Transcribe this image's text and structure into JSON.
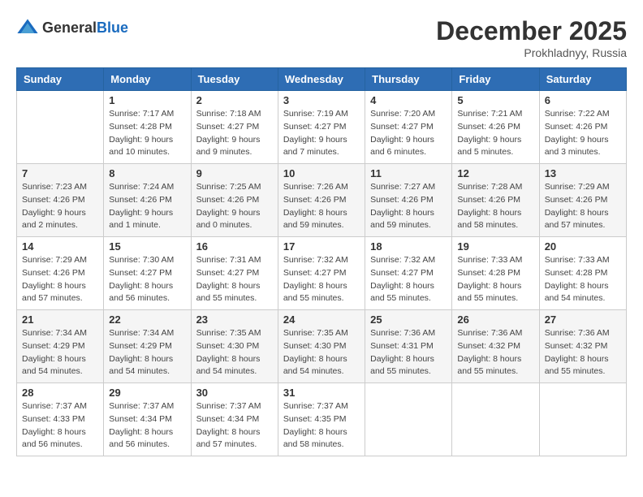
{
  "logo": {
    "general": "General",
    "blue": "Blue"
  },
  "title": "December 2025",
  "location": "Prokhladnyy, Russia",
  "days_of_week": [
    "Sunday",
    "Monday",
    "Tuesday",
    "Wednesday",
    "Thursday",
    "Friday",
    "Saturday"
  ],
  "weeks": [
    [
      {
        "day": "",
        "info": ""
      },
      {
        "day": "1",
        "info": "Sunrise: 7:17 AM\nSunset: 4:28 PM\nDaylight: 9 hours\nand 10 minutes."
      },
      {
        "day": "2",
        "info": "Sunrise: 7:18 AM\nSunset: 4:27 PM\nDaylight: 9 hours\nand 9 minutes."
      },
      {
        "day": "3",
        "info": "Sunrise: 7:19 AM\nSunset: 4:27 PM\nDaylight: 9 hours\nand 7 minutes."
      },
      {
        "day": "4",
        "info": "Sunrise: 7:20 AM\nSunset: 4:27 PM\nDaylight: 9 hours\nand 6 minutes."
      },
      {
        "day": "5",
        "info": "Sunrise: 7:21 AM\nSunset: 4:26 PM\nDaylight: 9 hours\nand 5 minutes."
      },
      {
        "day": "6",
        "info": "Sunrise: 7:22 AM\nSunset: 4:26 PM\nDaylight: 9 hours\nand 3 minutes."
      }
    ],
    [
      {
        "day": "7",
        "info": "Sunrise: 7:23 AM\nSunset: 4:26 PM\nDaylight: 9 hours\nand 2 minutes."
      },
      {
        "day": "8",
        "info": "Sunrise: 7:24 AM\nSunset: 4:26 PM\nDaylight: 9 hours\nand 1 minute."
      },
      {
        "day": "9",
        "info": "Sunrise: 7:25 AM\nSunset: 4:26 PM\nDaylight: 9 hours\nand 0 minutes."
      },
      {
        "day": "10",
        "info": "Sunrise: 7:26 AM\nSunset: 4:26 PM\nDaylight: 8 hours\nand 59 minutes."
      },
      {
        "day": "11",
        "info": "Sunrise: 7:27 AM\nSunset: 4:26 PM\nDaylight: 8 hours\nand 59 minutes."
      },
      {
        "day": "12",
        "info": "Sunrise: 7:28 AM\nSunset: 4:26 PM\nDaylight: 8 hours\nand 58 minutes."
      },
      {
        "day": "13",
        "info": "Sunrise: 7:29 AM\nSunset: 4:26 PM\nDaylight: 8 hours\nand 57 minutes."
      }
    ],
    [
      {
        "day": "14",
        "info": "Sunrise: 7:29 AM\nSunset: 4:26 PM\nDaylight: 8 hours\nand 57 minutes."
      },
      {
        "day": "15",
        "info": "Sunrise: 7:30 AM\nSunset: 4:27 PM\nDaylight: 8 hours\nand 56 minutes."
      },
      {
        "day": "16",
        "info": "Sunrise: 7:31 AM\nSunset: 4:27 PM\nDaylight: 8 hours\nand 55 minutes."
      },
      {
        "day": "17",
        "info": "Sunrise: 7:32 AM\nSunset: 4:27 PM\nDaylight: 8 hours\nand 55 minutes."
      },
      {
        "day": "18",
        "info": "Sunrise: 7:32 AM\nSunset: 4:27 PM\nDaylight: 8 hours\nand 55 minutes."
      },
      {
        "day": "19",
        "info": "Sunrise: 7:33 AM\nSunset: 4:28 PM\nDaylight: 8 hours\nand 55 minutes."
      },
      {
        "day": "20",
        "info": "Sunrise: 7:33 AM\nSunset: 4:28 PM\nDaylight: 8 hours\nand 54 minutes."
      }
    ],
    [
      {
        "day": "21",
        "info": "Sunrise: 7:34 AM\nSunset: 4:29 PM\nDaylight: 8 hours\nand 54 minutes."
      },
      {
        "day": "22",
        "info": "Sunrise: 7:34 AM\nSunset: 4:29 PM\nDaylight: 8 hours\nand 54 minutes."
      },
      {
        "day": "23",
        "info": "Sunrise: 7:35 AM\nSunset: 4:30 PM\nDaylight: 8 hours\nand 54 minutes."
      },
      {
        "day": "24",
        "info": "Sunrise: 7:35 AM\nSunset: 4:30 PM\nDaylight: 8 hours\nand 54 minutes."
      },
      {
        "day": "25",
        "info": "Sunrise: 7:36 AM\nSunset: 4:31 PM\nDaylight: 8 hours\nand 55 minutes."
      },
      {
        "day": "26",
        "info": "Sunrise: 7:36 AM\nSunset: 4:32 PM\nDaylight: 8 hours\nand 55 minutes."
      },
      {
        "day": "27",
        "info": "Sunrise: 7:36 AM\nSunset: 4:32 PM\nDaylight: 8 hours\nand 55 minutes."
      }
    ],
    [
      {
        "day": "28",
        "info": "Sunrise: 7:37 AM\nSunset: 4:33 PM\nDaylight: 8 hours\nand 56 minutes."
      },
      {
        "day": "29",
        "info": "Sunrise: 7:37 AM\nSunset: 4:34 PM\nDaylight: 8 hours\nand 56 minutes."
      },
      {
        "day": "30",
        "info": "Sunrise: 7:37 AM\nSunset: 4:34 PM\nDaylight: 8 hours\nand 57 minutes."
      },
      {
        "day": "31",
        "info": "Sunrise: 7:37 AM\nSunset: 4:35 PM\nDaylight: 8 hours\nand 58 minutes."
      },
      {
        "day": "",
        "info": ""
      },
      {
        "day": "",
        "info": ""
      },
      {
        "day": "",
        "info": ""
      }
    ]
  ]
}
